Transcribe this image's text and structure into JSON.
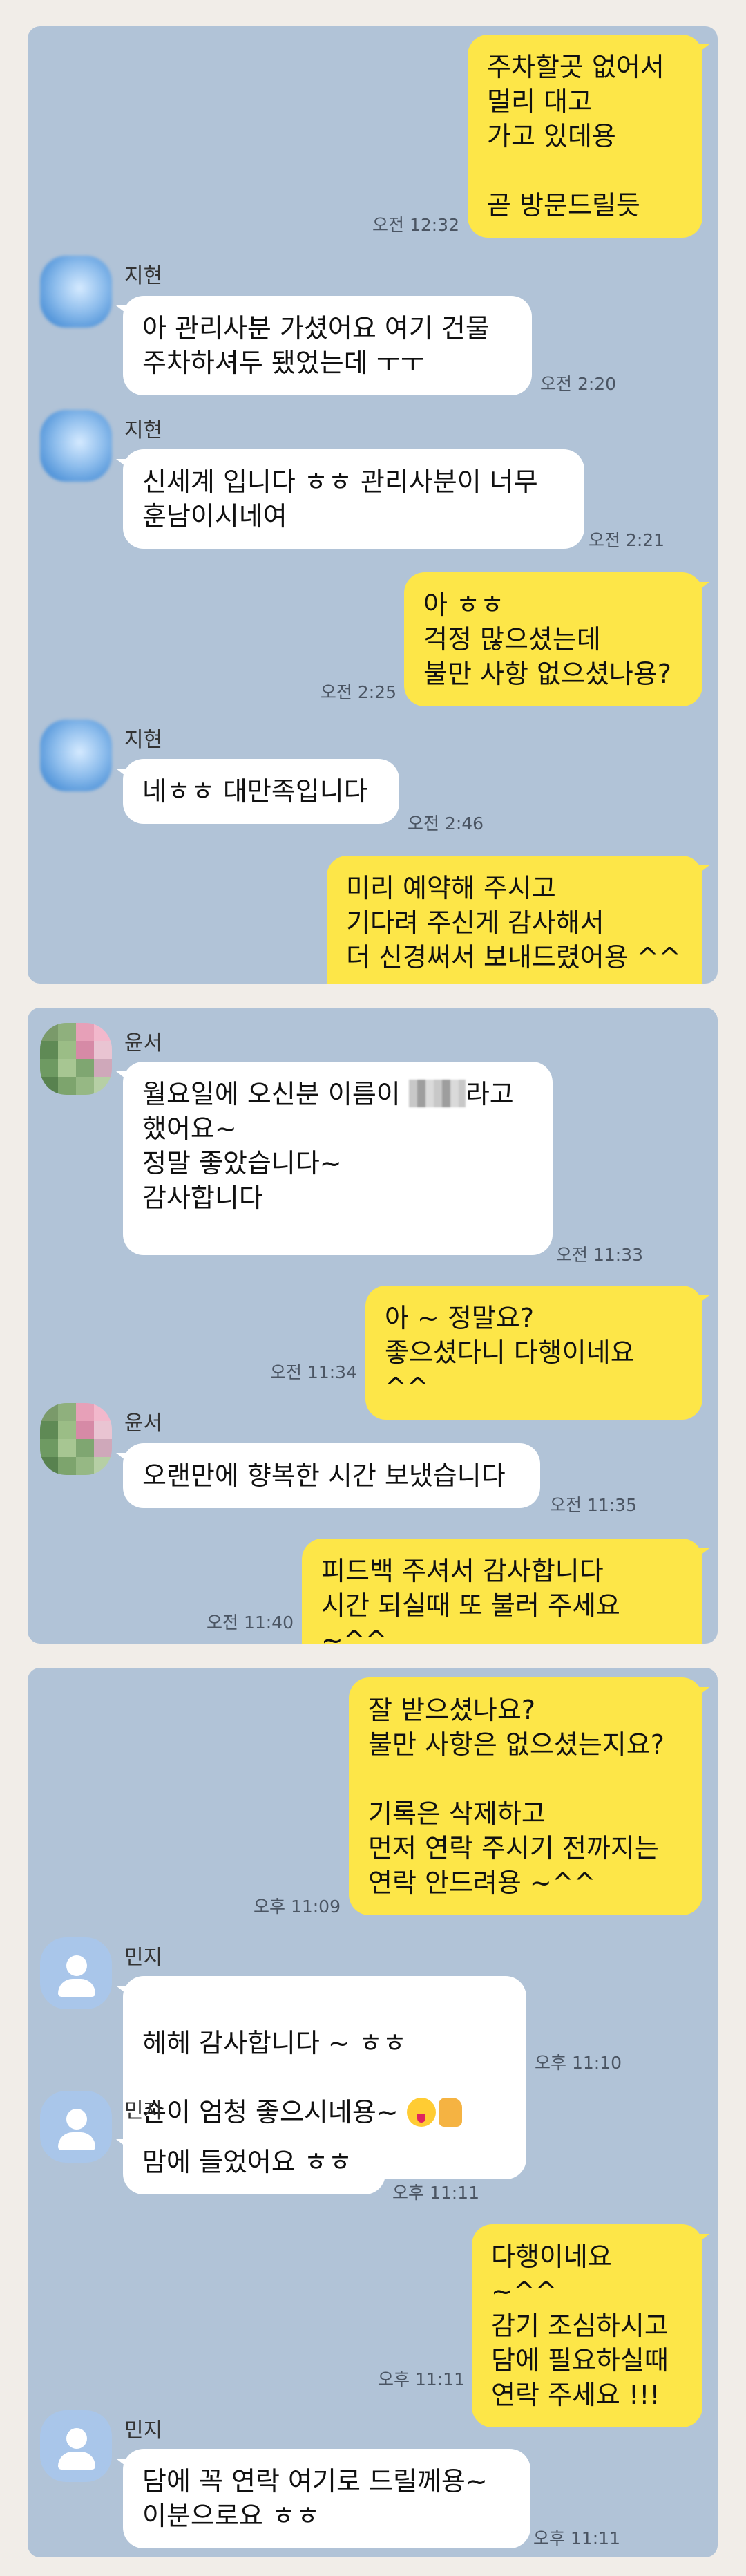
{
  "panels": [
    {
      "messages": [
        {
          "sender": "me",
          "text": "주차할곳 없어서\n멀리 대고\n가고 있데용\n\n곧 방문드릴듯",
          "time": "오전 12:32"
        },
        {
          "sender": "other",
          "name": "지현",
          "text": "아 관리사분 가셨어요 여기 건물\n주차하셔두 됐었는데 ㅜㅜ",
          "time": "오전 2:20"
        },
        {
          "sender": "other",
          "name": "지현",
          "text": "신세계 입니다 ㅎㅎ 관리사분이 너무\n훈남이시네여",
          "time": "오전 2:21"
        },
        {
          "sender": "me",
          "text": "아 ㅎㅎ\n걱정 많으셨는데\n불만 사항 없으셨나용?",
          "time": "오전 2:25"
        },
        {
          "sender": "other",
          "name": "지현",
          "text": "네ㅎㅎ 대만족입니다",
          "time": "오전 2:46"
        },
        {
          "sender": "me",
          "text": "미리 예약해 주시고\n기다려 주신게 감사해서\n더 신경써서 보내드렸어용 ^^",
          "time": ""
        }
      ]
    },
    {
      "messages": [
        {
          "sender": "other",
          "name": "윤서",
          "text_before": "월요일에 오신분 이름이 ",
          "text_after": "라고\n했어요~\n정말 좋았습니다~\n감사합니다",
          "time": "오전 11:33"
        },
        {
          "sender": "me",
          "text": "아 ~ 정말요?\n좋으셨다니 다행이네요 ^^",
          "time": "오전 11:34"
        },
        {
          "sender": "other",
          "name": "윤서",
          "text": "오랜만에 향복한 시간 보냈습니다",
          "time": "오전 11:35"
        },
        {
          "sender": "me",
          "text": "피드백 주셔서 감사합니다\n시간 되실때 또 불러 주세요 ~^^",
          "time": "오전 11:40"
        }
      ]
    },
    {
      "messages": [
        {
          "sender": "me",
          "text": "잘 받으셨나요?\n불만 사항은 없으셨는지요?\n\n기록은 삭제하고\n먼저 연락 주시기 전까지는\n연락 안드려용 ~^^",
          "time": "오후 11:09"
        },
        {
          "sender": "other",
          "name": "민지",
          "text_line1": "헤헤 감사합니다 ~ ㅎㅎ",
          "text_line2": "손이 엄청 좋으시네용~",
          "emoji_1": "winking-tongue-emoji",
          "emoji_2": "thumbs-up-emoji",
          "time": "오후 11:10"
        },
        {
          "sender": "other",
          "name": "민지",
          "text": "맘에 들었어요 ㅎㅎ",
          "time": "오후 11:11"
        },
        {
          "sender": "me",
          "text": "다행이네요 ~^^\n감기 조심하시고\n담에 필요하실때\n연락 주세요 !!!",
          "time": "오후 11:11"
        },
        {
          "sender": "other",
          "name": "민지",
          "text": "담에 꼭 연락 여기로 드릴께용~\n이분으로요 ㅎㅎ",
          "time": "오후 11:11"
        }
      ]
    }
  ],
  "colors": {
    "chat_background": "#b1c3d7",
    "my_bubble": "#fde648",
    "other_bubble": "#ffffff",
    "page_background": "#f1ede8"
  }
}
